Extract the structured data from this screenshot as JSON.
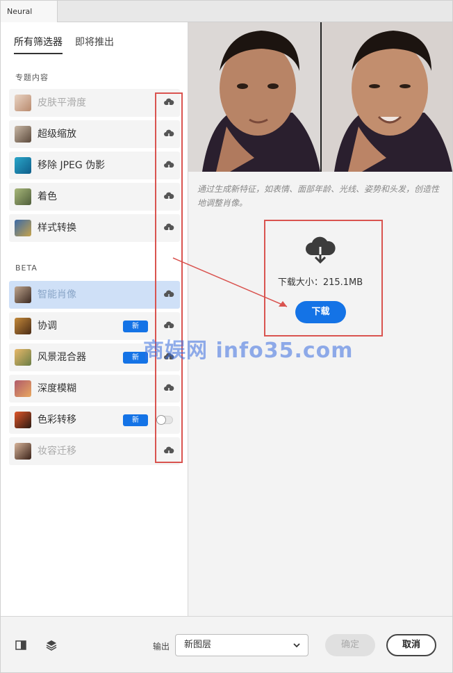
{
  "window": {
    "tab_title": "Neural Filters"
  },
  "subtabs": [
    {
      "label": "所有筛选器",
      "active": true
    },
    {
      "label": "即将推出",
      "active": false
    }
  ],
  "sections": {
    "featured": "专题内容",
    "beta": "BETA"
  },
  "featured_filters": [
    {
      "label": "皮肤平滑度",
      "state": "disabled",
      "icon": "cloud-download-icon"
    },
    {
      "label": "超级缩放",
      "state": "normal",
      "icon": "cloud-download-icon"
    },
    {
      "label": "移除 JPEG 伪影",
      "state": "normal",
      "icon": "cloud-download-icon"
    },
    {
      "label": "着色",
      "state": "normal",
      "icon": "cloud-download-icon"
    },
    {
      "label": "样式转换",
      "state": "normal",
      "icon": "cloud-download-icon"
    }
  ],
  "beta_filters": [
    {
      "label": "智能肖像",
      "state": "selected",
      "icon": "cloud-download-icon",
      "badge": ""
    },
    {
      "label": "协调",
      "state": "normal",
      "icon": "cloud-download-icon",
      "badge": "新"
    },
    {
      "label": "风景混合器",
      "state": "normal",
      "icon": "cloud-download-icon",
      "badge": "新"
    },
    {
      "label": "深度模糊",
      "state": "normal",
      "icon": "cloud-download-icon",
      "badge": ""
    },
    {
      "label": "色彩转移",
      "state": "normal",
      "icon": "toggle",
      "badge": "新"
    },
    {
      "label": "妆容迁移",
      "state": "disabled",
      "icon": "cloud-download-icon",
      "badge": ""
    }
  ],
  "detail": {
    "description": "通过生成新特征，如表情、面部年龄、光线、姿势和头发，创造性地调整肖像。",
    "download_size": "下载大小：215.1MB",
    "download_button": "下载"
  },
  "watermark": "商娱网 info35.com",
  "bottom": {
    "output_label": "输出",
    "output_value": "新图层",
    "ok_label": "确定",
    "cancel_label": "取消"
  },
  "colors": {
    "accent": "#1473e6",
    "selected_row": "#cfe0f7",
    "annotation_red": "#d9534f"
  }
}
